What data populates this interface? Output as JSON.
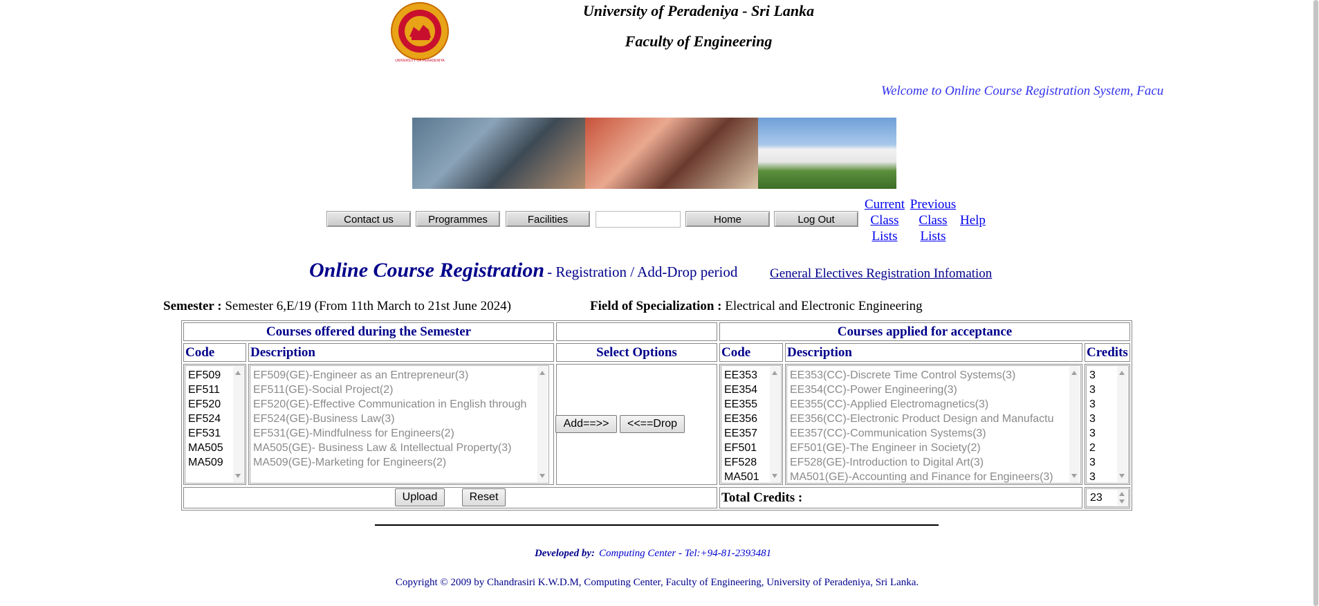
{
  "header": {
    "university": "University of Peradeniya - Sri Lanka",
    "faculty": "Faculty of Engineering",
    "logo_caption": "UNIVERSITY OF PERADENIYA",
    "marquee": "Welcome to Online Course Registration System, Facu"
  },
  "nav": {
    "contact": "Contact us",
    "programmes": "Programmes",
    "facilities": "Facilities",
    "home": "Home",
    "logout": "Log Out",
    "current_class_lists": [
      "Current",
      "Class",
      "Lists"
    ],
    "previous_class_lists": [
      "Previous",
      "Class",
      "Lists"
    ],
    "help": "Help"
  },
  "headline": {
    "title": "Online Course Registration",
    "subtitle": "- Registration / Add-Drop period",
    "ge_link": "General Electives Registration Infomation"
  },
  "semester": {
    "label": "Semester :",
    "value": "Semester 6,E/19 (From 11th March to 21st June 2024)"
  },
  "specialization": {
    "label": "Field of Specialization :",
    "value": "Electrical and Electronic Engineering"
  },
  "offered": {
    "heading": "Courses offered during the Semester",
    "code_header": "Code",
    "desc_header": "Description",
    "codes": [
      "EF509",
      "EF511",
      "EF520",
      "EF524",
      "EF531",
      "MA505",
      "MA509"
    ],
    "descriptions": [
      "EF509(GE)-Engineer as an Entrepreneur(3)",
      "EF511(GE)-Social Project(2)",
      "EF520(GE)-Effective Communication in English through",
      "EF524(GE)-Business Law(3)",
      "EF531(GE)-Mindfulness for Engineers(2)",
      "MA505(GE)- Business Law & Intellectual Property(3)",
      "MA509(GE)-Marketing for Engineers(2)"
    ]
  },
  "options": {
    "heading": "Select Options",
    "add": "Add==>>",
    "drop": "<<==Drop",
    "upload": "Upload",
    "reset": "Reset"
  },
  "applied": {
    "heading": "Courses applied for acceptance",
    "code_header": "Code",
    "desc_header": "Description",
    "credits_header": "Credits",
    "codes": [
      "EE353",
      "EE354",
      "EE355",
      "EE356",
      "EE357",
      "EF501",
      "EF528",
      "MA501"
    ],
    "descriptions": [
      "EE353(CC)-Discrete Time Control Systems(3)",
      "EE354(CC)-Power Engineering(3)",
      "EE355(CC)-Applied Electromagnetics(3)",
      "EE356(CC)-Electronic Product Design and Manufactu",
      "EE357(CC)-Communication Systems(3)",
      "EF501(GE)-The Engineer in Society(2)",
      "EF528(GE)-Introduction to Digital Art(3)",
      "MA501(GE)-Accounting and Finance for Engineers(3)"
    ],
    "credits": [
      "3",
      "3",
      "3",
      "3",
      "3",
      "2",
      "3",
      "3"
    ],
    "total_label": "Total Credits :",
    "total_value": "23"
  },
  "footer": {
    "developed_label": "Developed by:",
    "developed_value": "Computing Center - Tel:+94-81-2393481",
    "copyright": "Copyright © 2009 by Chandrasiri K.W.D.M, Computing Center, Faculty of Engineering, University of Peradeniya, Sri Lanka."
  },
  "colors": {
    "accent": "#00008b",
    "link": "#0000ee",
    "marquee": "#3333ee",
    "logo_gold": "#e8a317",
    "logo_red": "#c8102e"
  },
  "icons": [
    "university-logo",
    "scroll-up-arrow",
    "scroll-down-arrow",
    "spinner-arrows"
  ]
}
